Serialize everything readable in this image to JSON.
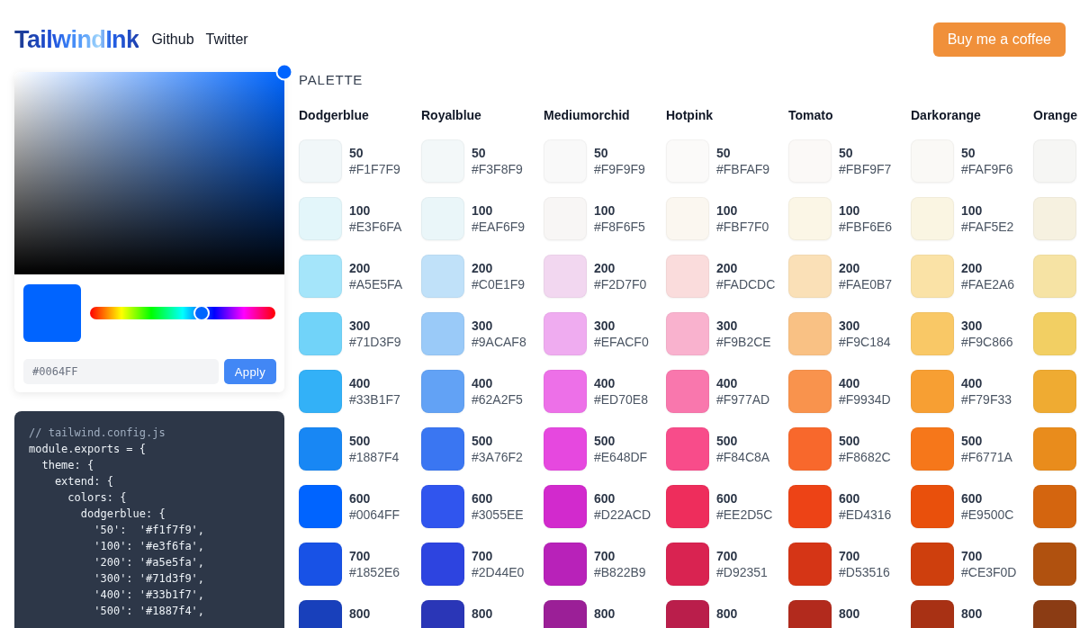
{
  "header": {
    "logo": "TailwindInk",
    "links": [
      "Github",
      "Twitter"
    ],
    "button": "Buy me a coffee"
  },
  "picker": {
    "hue": {
      "level": 0.6
    },
    "value": "#0064FF",
    "apply": "Apply"
  },
  "config_code": {
    "lines": [
      {
        "kind": "comment",
        "text": "// tailwind.config.js"
      },
      {
        "kind": "code",
        "text": "module.exports = {"
      },
      {
        "kind": "code",
        "text": "  theme: {"
      },
      {
        "kind": "code",
        "text": "    extend: {"
      },
      {
        "kind": "code",
        "text": "      colors: {"
      },
      {
        "kind": "code",
        "text": "        dodgerblue: {"
      },
      {
        "kind": "code",
        "text": "          '50':  '#f1f7f9',"
      },
      {
        "kind": "code",
        "text": "          '100': '#e3f6fa',"
      },
      {
        "kind": "code",
        "text": "          '200': '#a5e5fa',"
      },
      {
        "kind": "code",
        "text": "          '300': '#71d3f9',"
      },
      {
        "kind": "code",
        "text": "          '400': '#33b1f7',"
      },
      {
        "kind": "code",
        "text": "          '500': '#1887f4',"
      }
    ]
  },
  "palette": {
    "title": "PALETTE",
    "columns": [
      {
        "name": "Dodgerblue",
        "shades": [
          {
            "label": "50",
            "hex": "#F1F7F9",
            "color": "#f1f7f9"
          },
          {
            "label": "100",
            "hex": "#E3F6FA",
            "color": "#e3f6fa"
          },
          {
            "label": "200",
            "hex": "#A5E5FA",
            "color": "#a5e5fa"
          },
          {
            "label": "300",
            "hex": "#71D3F9",
            "color": "#71d3f9"
          },
          {
            "label": "400",
            "hex": "#33B1F7",
            "color": "#33b1f7"
          },
          {
            "label": "500",
            "hex": "#1887F4",
            "color": "#1887f4"
          },
          {
            "label": "600",
            "hex": "#0064FF",
            "color": "#0064ff"
          },
          {
            "label": "700",
            "hex": "#1852E6",
            "color": "#1852e6"
          },
          {
            "label": "800",
            "color": "#1840bb"
          }
        ]
      },
      {
        "name": "Royalblue",
        "shades": [
          {
            "label": "50",
            "hex": "#F3F8F9",
            "color": "#f3f8f9"
          },
          {
            "label": "100",
            "hex": "#EAF6F9",
            "color": "#eaf6f9"
          },
          {
            "label": "200",
            "hex": "#C0E1F9",
            "color": "#c0e1f9"
          },
          {
            "label": "300",
            "hex": "#9ACAF8",
            "color": "#9acaf8"
          },
          {
            "label": "400",
            "hex": "#62A2F5",
            "color": "#62a2f5"
          },
          {
            "label": "500",
            "hex": "#3A76F2",
            "color": "#3a76f2"
          },
          {
            "label": "600",
            "hex": "#3055EE",
            "color": "#3055ee"
          },
          {
            "label": "700",
            "hex": "#2D44E0",
            "color": "#2d44e0"
          },
          {
            "label": "800",
            "color": "#2a36b7"
          }
        ]
      },
      {
        "name": "Mediumorchid",
        "shades": [
          {
            "label": "50",
            "hex": "#F9F9F9",
            "color": "#f9f9f9"
          },
          {
            "label": "100",
            "hex": "#F8F6F5",
            "color": "#f8f6f5"
          },
          {
            "label": "200",
            "hex": "#F2D7F0",
            "color": "#f2d7f0"
          },
          {
            "label": "300",
            "hex": "#EFACF0",
            "color": "#efacf0"
          },
          {
            "label": "400",
            "hex": "#ED70E8",
            "color": "#ed70e8"
          },
          {
            "label": "500",
            "hex": "#E648DF",
            "color": "#e648df"
          },
          {
            "label": "600",
            "hex": "#D22ACD",
            "color": "#d22acd"
          },
          {
            "label": "700",
            "hex": "#B822B9",
            "color": "#b822b9"
          },
          {
            "label": "800",
            "color": "#9b1f97"
          }
        ]
      },
      {
        "name": "Hotpink",
        "shades": [
          {
            "label": "50",
            "hex": "#FBFAF9",
            "color": "#fbfaf9"
          },
          {
            "label": "100",
            "hex": "#FBF7F0",
            "color": "#fbf7f0"
          },
          {
            "label": "200",
            "hex": "#FADCDC",
            "color": "#fadcdc"
          },
          {
            "label": "300",
            "hex": "#F9B2CE",
            "color": "#f9b2ce"
          },
          {
            "label": "400",
            "hex": "#F977AD",
            "color": "#f977ad"
          },
          {
            "label": "500",
            "hex": "#F84C8A",
            "color": "#f84c8a"
          },
          {
            "label": "600",
            "hex": "#EE2D5C",
            "color": "#ee2d5c"
          },
          {
            "label": "700",
            "hex": "#D92351",
            "color": "#d92351"
          },
          {
            "label": "800",
            "color": "#ba1e4b"
          }
        ]
      },
      {
        "name": "Tomato",
        "shades": [
          {
            "label": "50",
            "hex": "#FBF9F7",
            "color": "#fbf9f7"
          },
          {
            "label": "100",
            "hex": "#FBF6E6",
            "color": "#fbf6e6"
          },
          {
            "label": "200",
            "hex": "#FAE0B7",
            "color": "#fae0b7"
          },
          {
            "label": "300",
            "hex": "#F9C184",
            "color": "#f9c184"
          },
          {
            "label": "400",
            "hex": "#F9934D",
            "color": "#f9934d"
          },
          {
            "label": "500",
            "hex": "#F8682C",
            "color": "#f8682c"
          },
          {
            "label": "600",
            "hex": "#ED4316",
            "color": "#ed4316"
          },
          {
            "label": "700",
            "hex": "#D53516",
            "color": "#d53516"
          },
          {
            "label": "800",
            "color": "#b22a1d"
          }
        ]
      },
      {
        "name": "Darkorange",
        "shades": [
          {
            "label": "50",
            "hex": "#FAF9F6",
            "color": "#faf9f6"
          },
          {
            "label": "100",
            "hex": "#FAF5E2",
            "color": "#faf5e2"
          },
          {
            "label": "200",
            "hex": "#FAE2A6",
            "color": "#fae2a6"
          },
          {
            "label": "300",
            "hex": "#F9C866",
            "color": "#f9c866"
          },
          {
            "label": "400",
            "hex": "#F79F33",
            "color": "#f79f33"
          },
          {
            "label": "500",
            "hex": "#F6771A",
            "color": "#f6771a"
          },
          {
            "label": "600",
            "hex": "#E9500C",
            "color": "#e9500c"
          },
          {
            "label": "700",
            "hex": "#CE3F0D",
            "color": "#ce3f0d"
          },
          {
            "label": "800",
            "color": "#a83114"
          }
        ]
      },
      {
        "name": "Orange",
        "shades": [
          {
            "color": "#f6f6f4"
          },
          {
            "color": "#f6f1e0"
          },
          {
            "color": "#f6e3a4"
          },
          {
            "color": "#f2cf63"
          },
          {
            "color": "#efab32"
          },
          {
            "color": "#e98c1c"
          },
          {
            "color": "#d4650f"
          },
          {
            "color": "#b0510f"
          },
          {
            "color": "#8b3c14"
          }
        ]
      }
    ]
  }
}
